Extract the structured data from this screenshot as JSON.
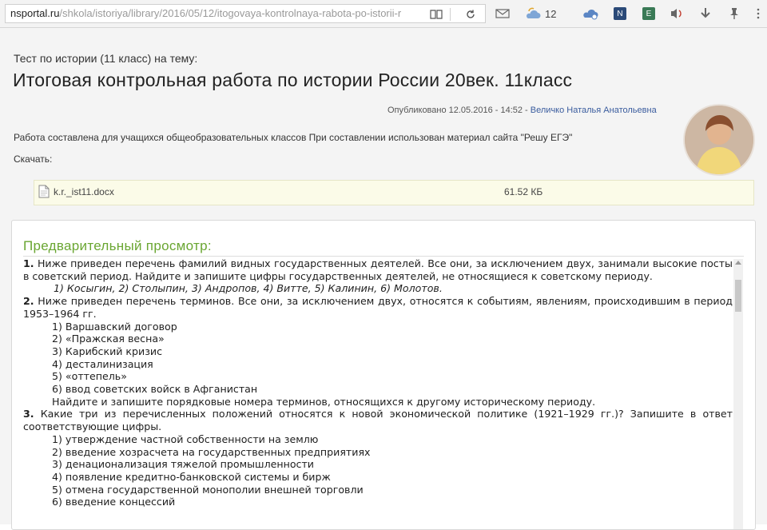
{
  "browser": {
    "url_host": "nsportal.ru",
    "url_path": "/shkola/istoriya/library/2016/05/12/itogovaya-kontrolnaya-rabota-po-istorii-r",
    "weather_temp": "12"
  },
  "page": {
    "topic_line": "Тест по истории (11 класс) на тему:",
    "title": "Итоговая контрольная работа по истории России 20век. 11класс",
    "published_prefix": "Опубликовано 12.05.2016 - 14:52 -",
    "author": "Величко Наталья Анатольевна",
    "description": "Работа составлена для учащихся общеобразовательных классов При составлении использован материал сайта \"Решу ЕГЭ\"",
    "download_label": "Скачать:",
    "file": {
      "name": "k.r._ist11.docx",
      "size": "61.52 КБ"
    }
  },
  "preview": {
    "heading": "Предварительный просмотр:",
    "q1": {
      "num": "1.",
      "text": "Ниже приведен перечень фамилий видных государственных деятелей. Все они, за исключением двух, занимали высокие посты в советский период. Найдите и запишите цифры государственных деятелей, не относящиеся к советскому периоду.",
      "options": "1) Косыгин, 2) Столыпин, 3) Андропов, 4) Витте, 5) Калинин, 6) Молотов."
    },
    "q2": {
      "num": "2.",
      "text": "Ниже приведен перечень терминов. Все они, за исключением двух, относятся к событиям, явлениям, происходившим в период 1953–1964 гг.",
      "options": [
        "1) Варшавский договор",
        "2) «Пражская весна»",
        "3) Карибский кризис",
        "4) десталинизация",
        "5) «оттепель»",
        "6) ввод советских войск в Афганистан"
      ],
      "tail": "Найдите и запишите порядковые номера терминов, относящихся к другому историческому периоду."
    },
    "q3": {
      "num": "3.",
      "text": "Какие три из перечисленных положений относятся к новой экономической политике (1921–1929 гг.)? Запишите в ответ соответствующие цифры.",
      "options": [
        "1) утверждение частной собственности на землю",
        "2) введение хозрасчета на государственных предприятиях",
        "3) денационализация тяжелой промышленности",
        "4) появление кредитно-банковской системы и бирж",
        "5) отмена государственной монополии внешней торговли",
        "6) введение концессий"
      ]
    }
  },
  "colors": {
    "heading_green": "#6aa632",
    "author_blue": "#3a5c9e",
    "file_row_bg": "#fbfbe8"
  }
}
